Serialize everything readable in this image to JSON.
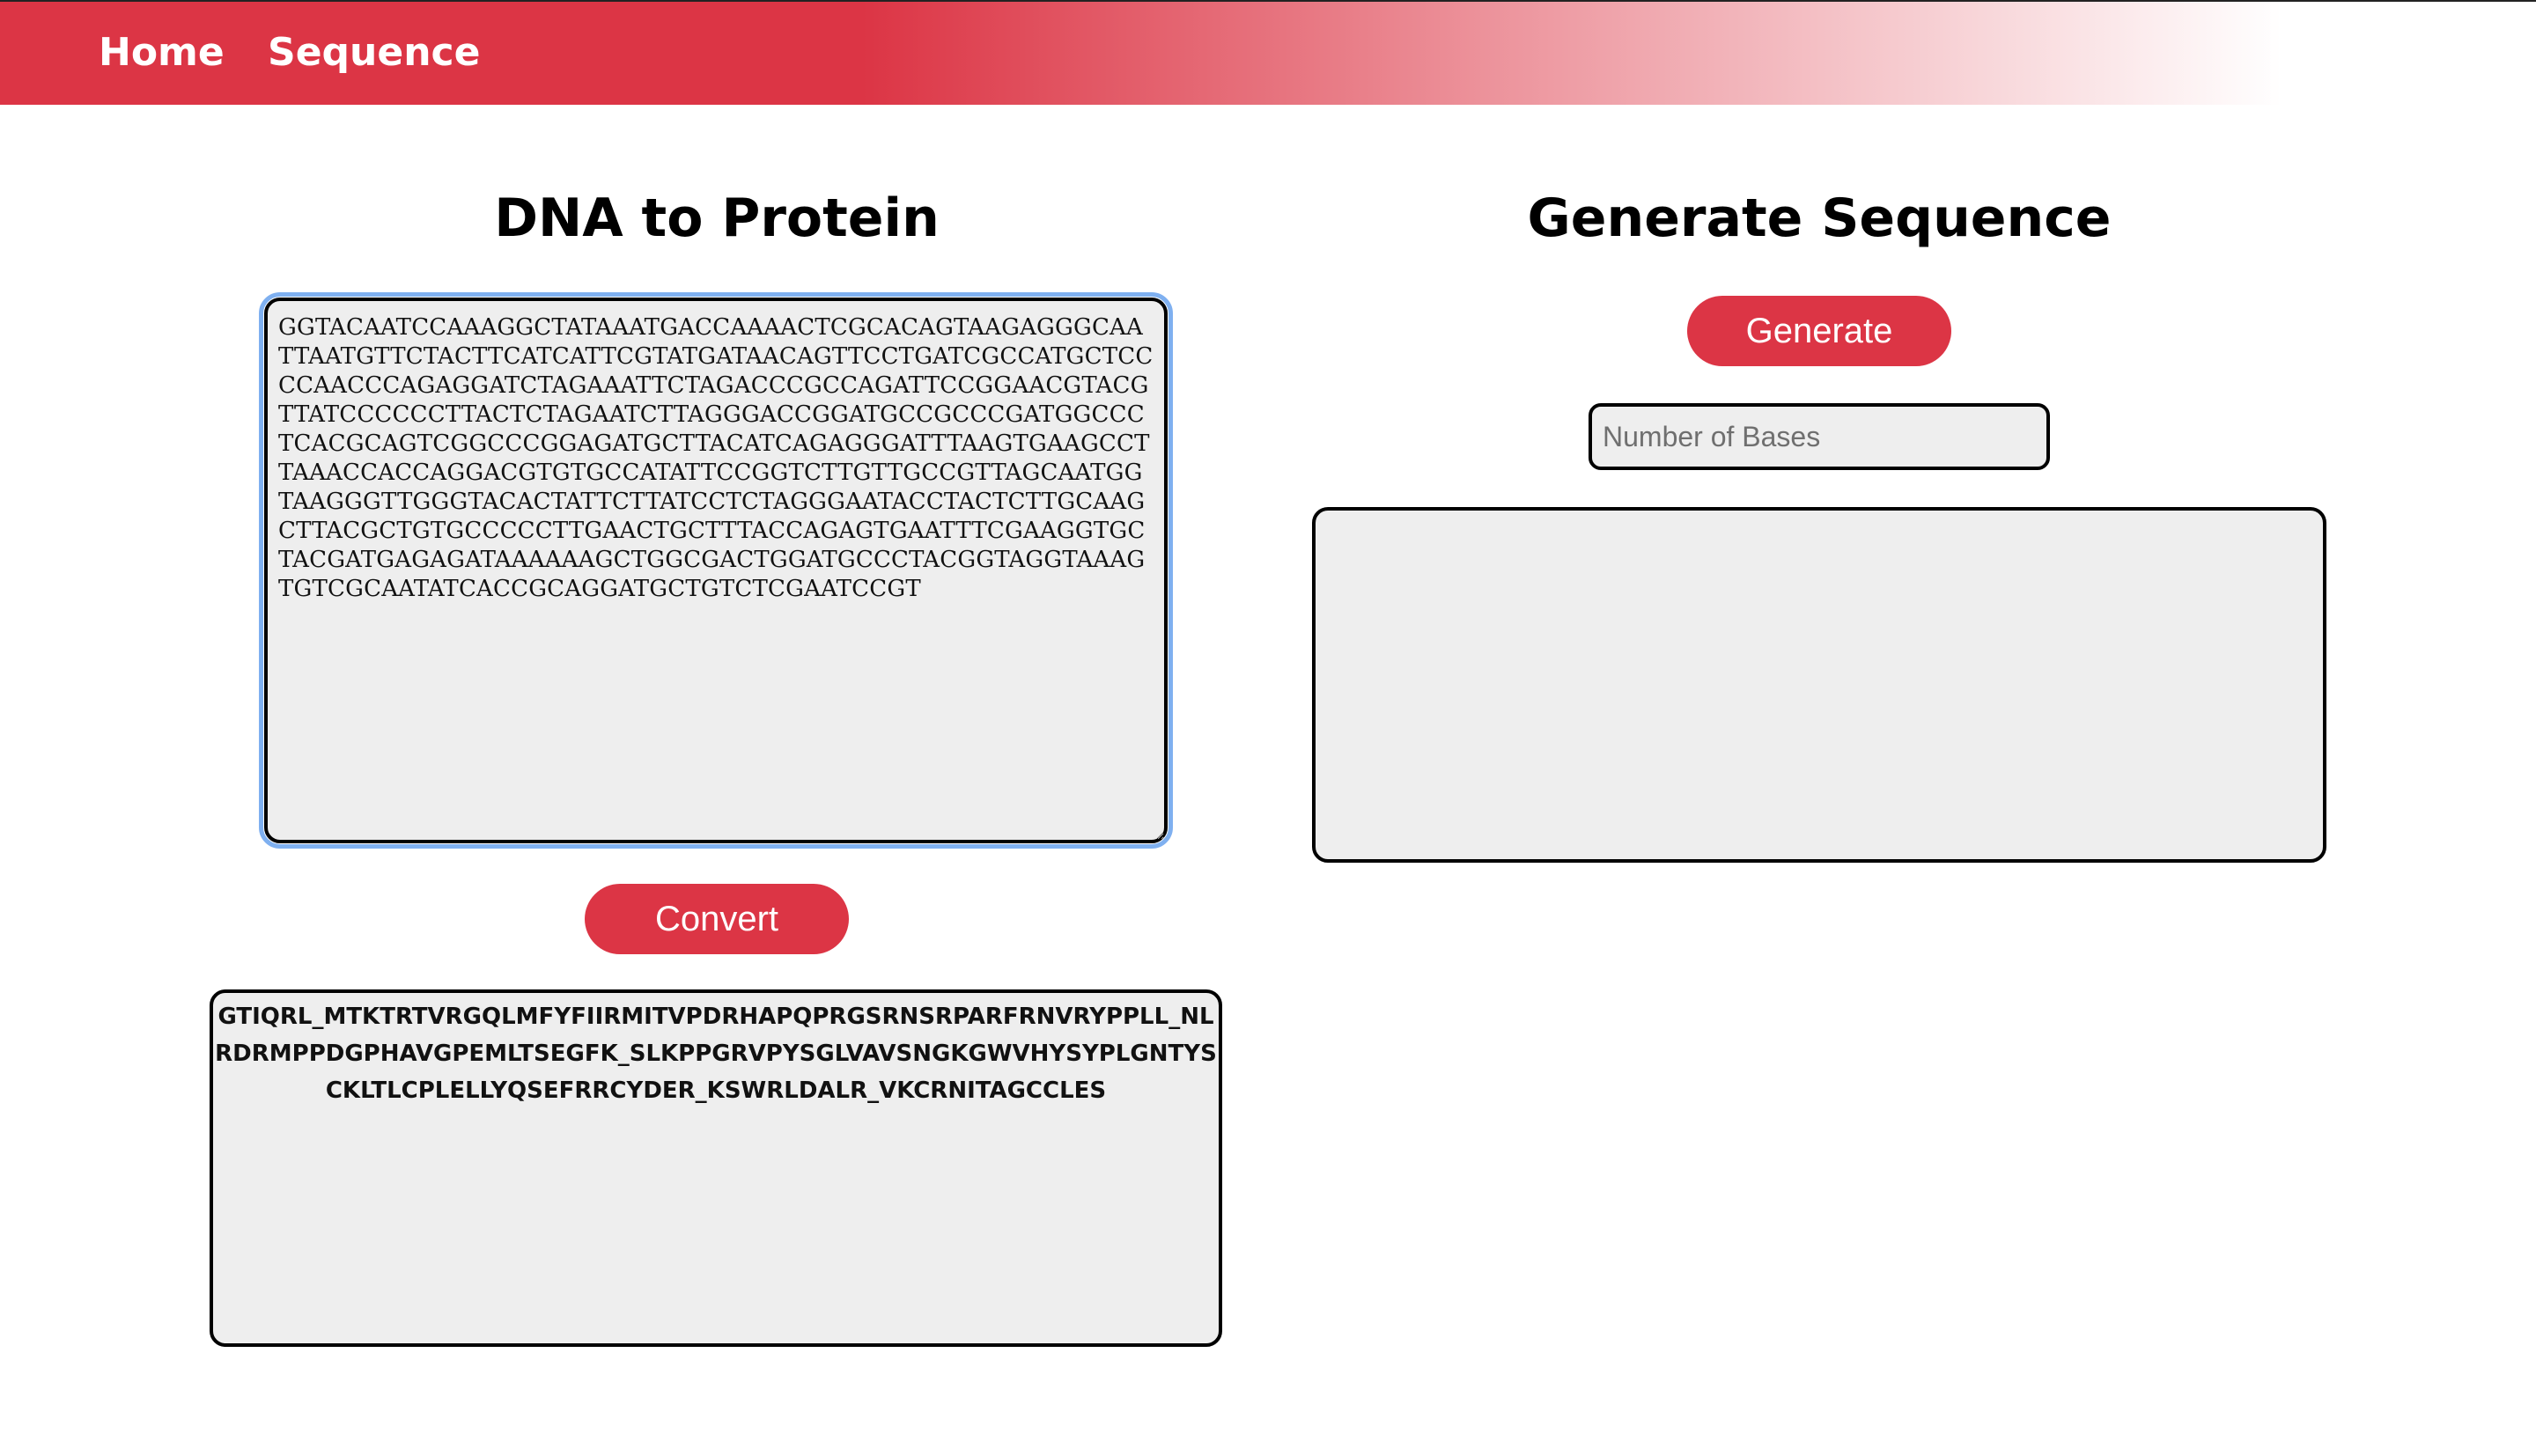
{
  "nav": {
    "home_label": "Home",
    "sequence_label": "Sequence"
  },
  "dna_to_protein": {
    "title": "DNA to Protein",
    "input_value": "GGTACAATCCAAAGGCTATAAATGACCAAAACTCGCACAGTAAGAGGGCAATTAATGTTCTACTTCATCATTCGTATGATAACAGTTCCTGATCGCCATGCTCCCCAACCCAGAGGATCTAGAAATTCTAGACCCGCCAGATTCCGGAACGTACGTTATCCCCCCTTACTCTAGAATCTTAGGGACCGGATGCCGCCCGATGGCCCTCACGCAGTCGGCCCGGAGATGCTTACATCAGAGGGATTTAAGTGAAGCCTTAAACCACCAGGACGTGTGCCATATTCCGGTCTTGTTGCCGTTAGCAATGGTAAGGGTTGGGTACACTATTCTTATCCTCTAGGGAATACCTACTCTTGCAAGCTTACGCTGTGCCCCCTTGAACTGCTTTACCAGAGTGAATTTCGAAGGTGCTACGATGAGAGATAAAAAAGCTGGCGACTGGATGCCCTACGGTAGGTAAAGTGTCGCAATATCACCGCAGGATGCTGTCTCGAATCCGT",
    "convert_label": "Convert",
    "output_value": "GTIQRL_MTKTRTVRGQLMFYFIIRMITVPDRHAPQPRGSRNSRPARFRNVRYPPLL_NLRDRMPPDGPHAVGPEMLTSEGFK_SLKPPGRVPYSGLVAVSNGKGWVHYSYPLGNTYSCKLTLCPLELLYQSEFRRCYDER_KSWRLDALR_VKCRNITAGCCLES"
  },
  "generate_sequence": {
    "title": "Generate Sequence",
    "generate_label": "Generate",
    "bases_placeholder": "Number of Bases",
    "bases_value": "",
    "output_value": ""
  },
  "colors": {
    "accent": "#dc3545",
    "field_background": "#eeeeee",
    "focus_ring": "#7fb0f0"
  }
}
